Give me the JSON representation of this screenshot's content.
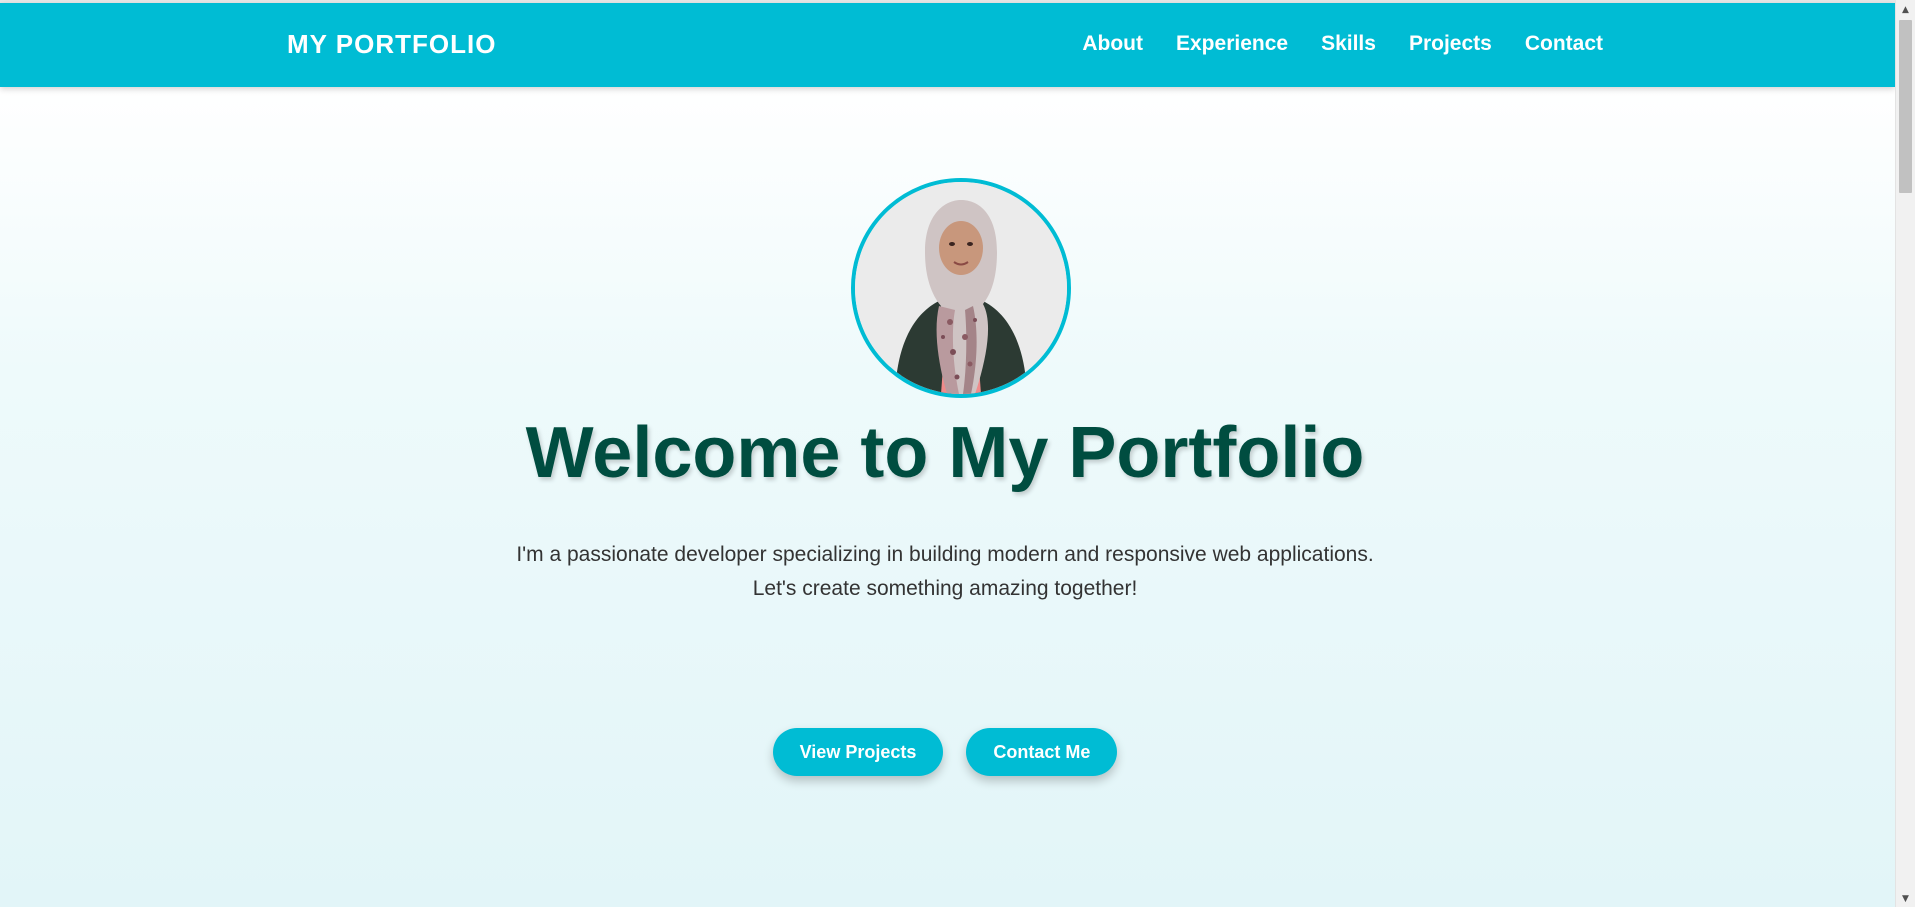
{
  "navbar": {
    "brand": "MY PORTFOLIO",
    "links": [
      "About",
      "Experience",
      "Skills",
      "Projects",
      "Contact"
    ]
  },
  "hero": {
    "avatar_alt": "profile-photo",
    "title": "Welcome to My Portfolio",
    "description_line1": "I'm a passionate developer specializing in building modern and responsive web applications.",
    "description_line2": "Let's create something amazing together!",
    "buttons": {
      "view_projects": "View Projects",
      "contact_me": "Contact Me"
    }
  },
  "scrollbar": {
    "up_arrow": "▲",
    "down_arrow": "▼"
  },
  "colors": {
    "accent": "#00bcd4",
    "title": "#004d40",
    "body_text": "#333333",
    "hero_bg_bottom": "#e2f5f8"
  }
}
